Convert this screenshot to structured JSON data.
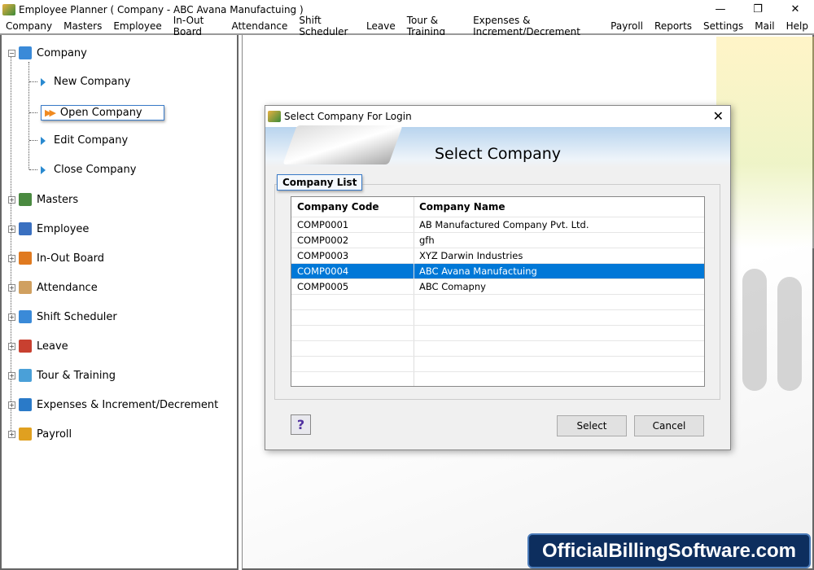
{
  "window": {
    "title": "Employee Planner ( Company - ABC Avana Manufactuing )",
    "minimize": "—",
    "maximize": "❐",
    "close": "✕"
  },
  "menu": [
    "Company",
    "Masters",
    "Employee",
    "In-Out Board",
    "Attendance",
    "Shift Scheduler",
    "Leave",
    "Tour & Training",
    "Expenses & Increment/Decrement",
    "Payroll",
    "Reports",
    "Settings",
    "Mail",
    "Help"
  ],
  "tree": {
    "company": "Company",
    "children": [
      "New Company",
      "Open Company",
      "Edit Company",
      "Close Company"
    ],
    "nodes": [
      "Masters",
      "Employee",
      "In-Out Board",
      "Attendance",
      "Shift Scheduler",
      "Leave",
      "Tour & Training",
      "Expenses & Increment/Decrement",
      "Payroll"
    ]
  },
  "dialog": {
    "title": "Select Company For Login",
    "heading": "Select Company",
    "group": "Company List",
    "columns": [
      "Company Code",
      "Company Name"
    ],
    "rows": [
      [
        "COMP0001",
        "AB Manufactured Company Pvt. Ltd."
      ],
      [
        "COMP0002",
        "gfh"
      ],
      [
        "COMP0003",
        "XYZ Darwin Industries"
      ],
      [
        "COMP0004",
        "ABC Avana Manufactuing"
      ],
      [
        "COMP0005",
        "ABC Comapny"
      ]
    ],
    "selected_row": 3,
    "help": "?",
    "select": "Select",
    "cancel": "Cancel",
    "close": "✕"
  },
  "watermark": "OfficialBillingSoftware.com",
  "colors": {
    "selection": "#0078d7",
    "tree_arrow": "#2a8ad0",
    "open_arrow": "#f08a20"
  }
}
